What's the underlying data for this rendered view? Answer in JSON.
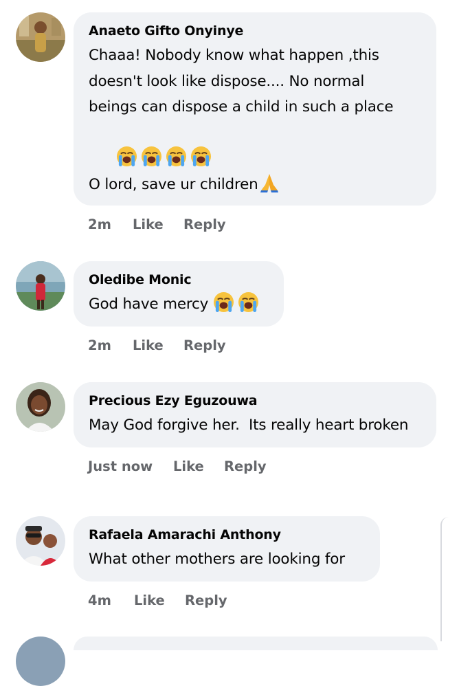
{
  "comments": [
    {
      "author": "Anaeto Gifto Onyinye",
      "line1": "Chaaa! Nobody know what happen ,this",
      "line2": "doesn't look like dispose.... No normal",
      "line3": "beings can dispose a child in such a place",
      "emojis": [
        "loudly-crying-face",
        "loudly-crying-face",
        "loudly-crying-face",
        "loudly-crying-face"
      ],
      "line5": "O lord, save ur children",
      "end_emoji": "folded-hands",
      "time": "2m",
      "like": "Like",
      "reply": "Reply"
    },
    {
      "author": "Oledibe Monic",
      "text": "God have mercy ",
      "emojis": [
        "loudly-crying-face",
        "loudly-crying-face"
      ],
      "time": "2m",
      "like": "Like",
      "reply": "Reply"
    },
    {
      "author": "Precious Ezy Eguzouwa",
      "text": "May God forgive her.  Its really heart broken",
      "time": "Just now",
      "like": "Like",
      "reply": "Reply"
    },
    {
      "author": "Rafaela Amarachi Anthony",
      "text": "What other mothers are looking for",
      "time": "4m",
      "like": "Like",
      "reply": "Reply"
    }
  ],
  "colors": {
    "bubble": "#f0f2f5",
    "meta": "#65676b",
    "text": "#050505"
  }
}
